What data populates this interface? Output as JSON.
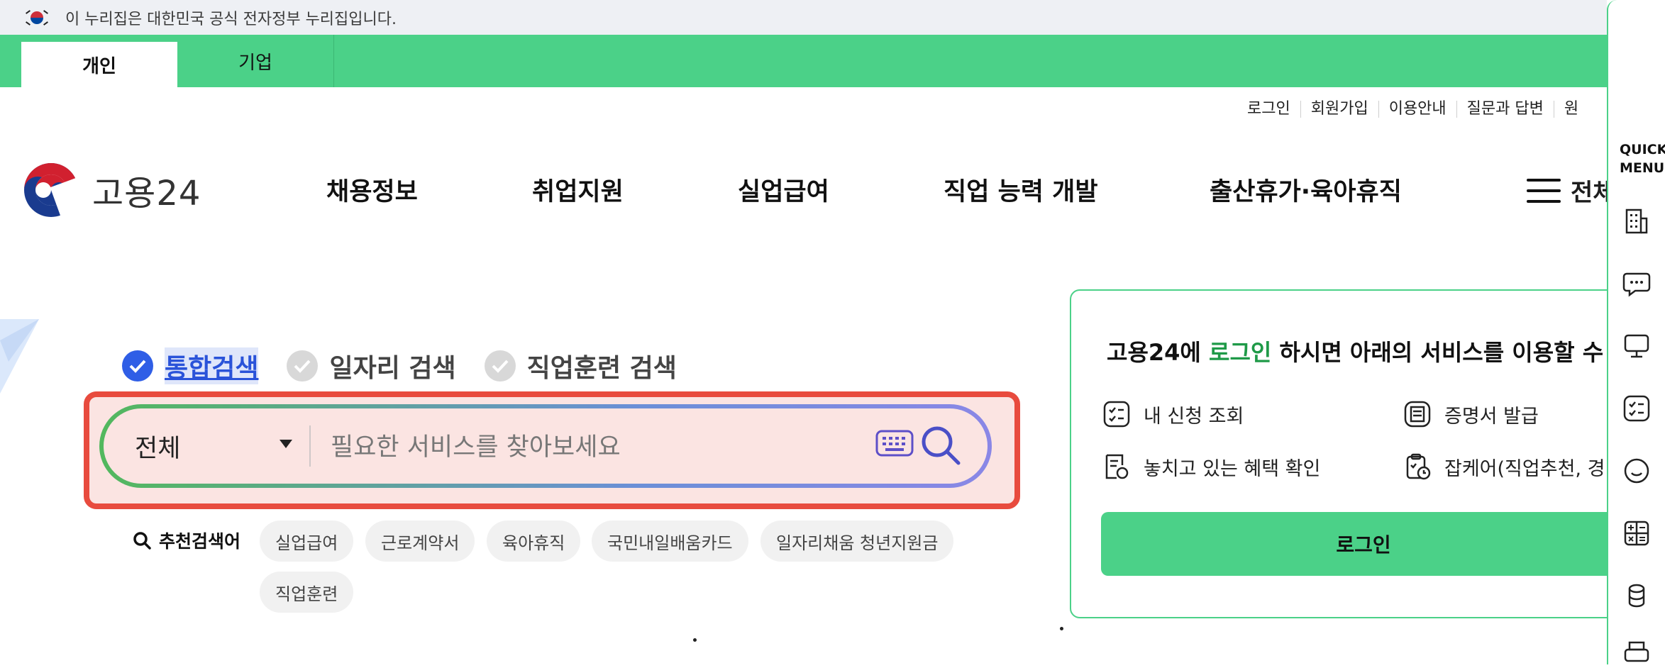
{
  "gov_banner": {
    "text": "이 누리집은 대한민국 공식 전자정부 누리집입니다."
  },
  "tabs": [
    {
      "label": "개인",
      "active": true
    },
    {
      "label": "기업",
      "active": false
    }
  ],
  "util_nav": [
    "로그인",
    "회원가입",
    "이용안내",
    "질문과 답변",
    "원"
  ],
  "logo": {
    "text": "고용24"
  },
  "gnb": [
    "채용정보",
    "취업지원",
    "실업급여",
    "직업 능력 개발",
    "출산휴가·육아휴직"
  ],
  "all_menu_label": "전체",
  "search": {
    "types": [
      {
        "label": "통합검색",
        "checked": true
      },
      {
        "label": "일자리 검색",
        "checked": false
      },
      {
        "label": "직업훈련 검색",
        "checked": false
      }
    ],
    "scope": "전체",
    "placeholder": "필요한 서비스를 찾아보세요",
    "recommend_label": "추천검색어",
    "keywords": [
      "실업급여",
      "근로계약서",
      "육아휴직",
      "국민내일배움카드",
      "일자리채움 청년지원금",
      "직업훈련"
    ]
  },
  "login_panel": {
    "title_prefix": "고용24에 ",
    "title_highlight": "로그인",
    "title_suffix": " 하시면 아래의 서비스를 이용할 수",
    "services": [
      "내 신청 조회",
      "증명서 발급",
      "놓치고 있는 혜택 확인",
      "잡케어(직업추천, 경"
    ],
    "button": "로그인"
  },
  "quick_menu": {
    "title_line1": "QUICK",
    "title_line2": "MENU"
  },
  "colors": {
    "brand_green": "#4bd188",
    "highlight_red": "#e84b3e",
    "active_blue": "#2f5ee6"
  }
}
